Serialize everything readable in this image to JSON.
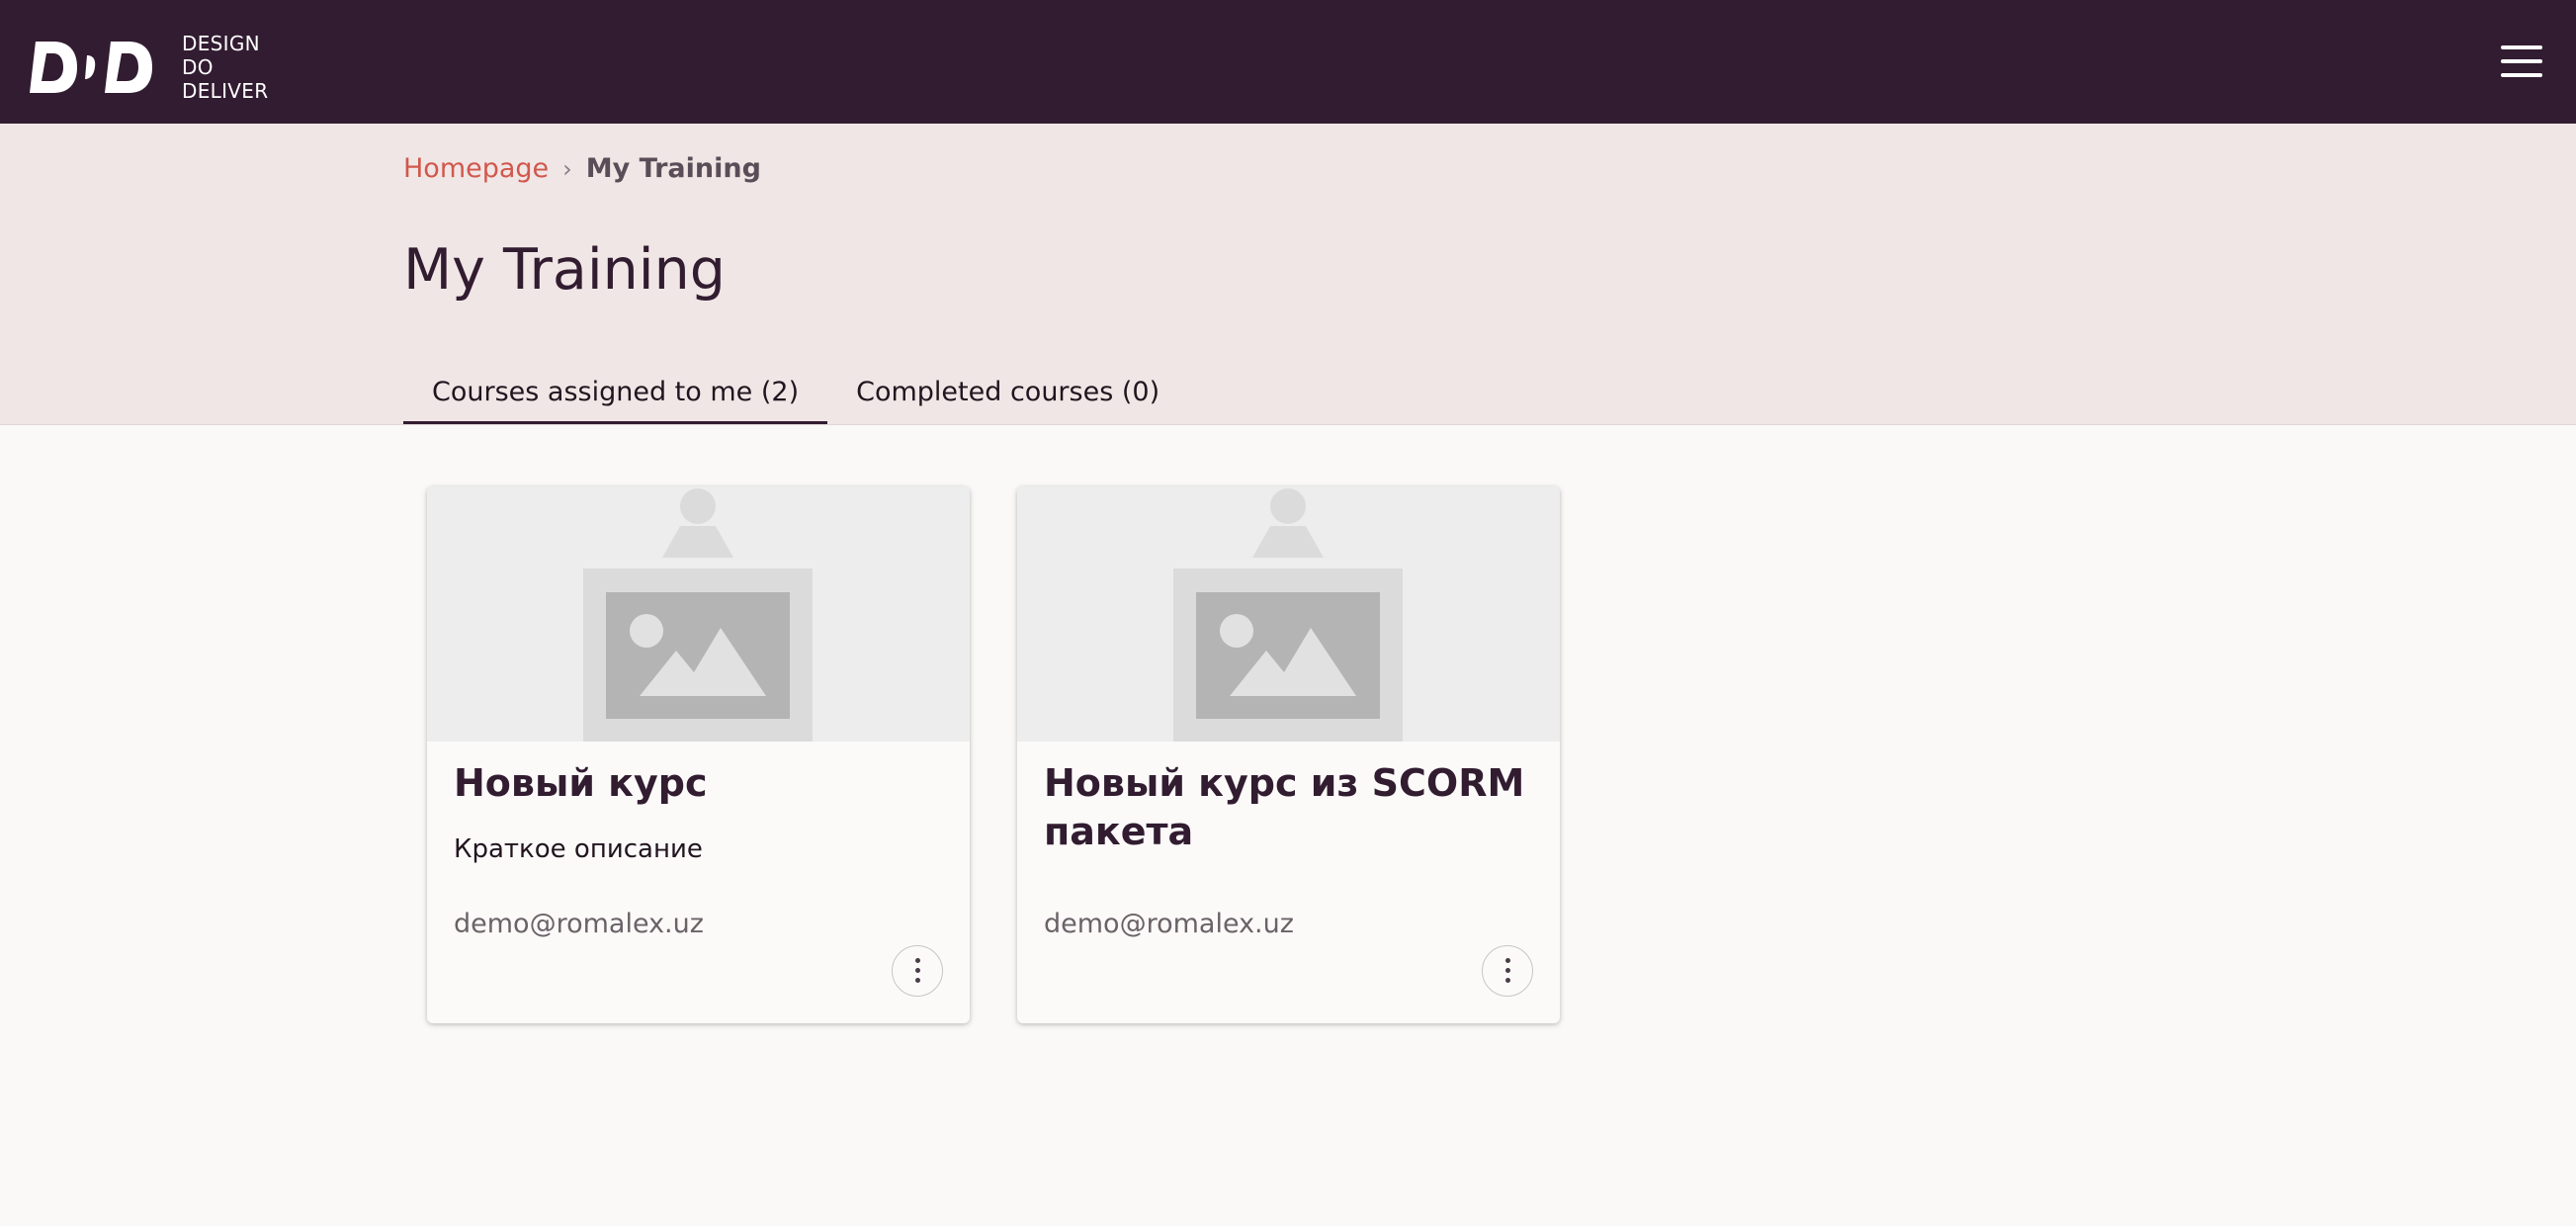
{
  "header": {
    "logo_lines": [
      "DESIGN",
      "DO",
      "DELIVER"
    ],
    "logo_mark": "DD",
    "menu_icon": "hamburger-menu-icon",
    "background": "#321c31"
  },
  "breadcrumb": {
    "home_label": "Homepage",
    "separator": "›",
    "current_label": "My Training"
  },
  "page": {
    "title": "My Training"
  },
  "tabs": [
    {
      "label": "Courses assigned to me (2)",
      "active": true
    },
    {
      "label": "Completed courses (0)",
      "active": false
    }
  ],
  "courses": [
    {
      "title": "Новый курс",
      "description": "Краткое описание",
      "author": "demo@romalex.uz",
      "image_icon": "image-placeholder-icon",
      "more_icon": "more-vertical-icon"
    },
    {
      "title": "Новый курс из SCORM пакета",
      "description": "",
      "author": "demo@romalex.uz",
      "image_icon": "image-placeholder-icon",
      "more_icon": "more-vertical-icon"
    }
  ],
  "colors": {
    "accent_link": "#d0584c",
    "hero_background": "#f1e6e6",
    "text_dark": "#311c30"
  }
}
